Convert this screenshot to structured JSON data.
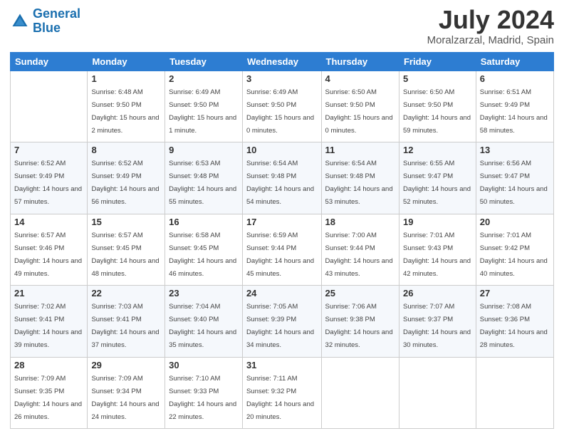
{
  "logo": {
    "line1": "General",
    "line2": "Blue"
  },
  "title": "July 2024",
  "location": "Moralzarzal, Madrid, Spain",
  "weekdays": [
    "Sunday",
    "Monday",
    "Tuesday",
    "Wednesday",
    "Thursday",
    "Friday",
    "Saturday"
  ],
  "weeks": [
    [
      {
        "date": "",
        "sunrise": "",
        "sunset": "",
        "daylight": ""
      },
      {
        "date": "1",
        "sunrise": "Sunrise: 6:48 AM",
        "sunset": "Sunset: 9:50 PM",
        "daylight": "Daylight: 15 hours and 2 minutes."
      },
      {
        "date": "2",
        "sunrise": "Sunrise: 6:49 AM",
        "sunset": "Sunset: 9:50 PM",
        "daylight": "Daylight: 15 hours and 1 minute."
      },
      {
        "date": "3",
        "sunrise": "Sunrise: 6:49 AM",
        "sunset": "Sunset: 9:50 PM",
        "daylight": "Daylight: 15 hours and 0 minutes."
      },
      {
        "date": "4",
        "sunrise": "Sunrise: 6:50 AM",
        "sunset": "Sunset: 9:50 PM",
        "daylight": "Daylight: 15 hours and 0 minutes."
      },
      {
        "date": "5",
        "sunrise": "Sunrise: 6:50 AM",
        "sunset": "Sunset: 9:50 PM",
        "daylight": "Daylight: 14 hours and 59 minutes."
      },
      {
        "date": "6",
        "sunrise": "Sunrise: 6:51 AM",
        "sunset": "Sunset: 9:49 PM",
        "daylight": "Daylight: 14 hours and 58 minutes."
      }
    ],
    [
      {
        "date": "7",
        "sunrise": "Sunrise: 6:52 AM",
        "sunset": "Sunset: 9:49 PM",
        "daylight": "Daylight: 14 hours and 57 minutes."
      },
      {
        "date": "8",
        "sunrise": "Sunrise: 6:52 AM",
        "sunset": "Sunset: 9:49 PM",
        "daylight": "Daylight: 14 hours and 56 minutes."
      },
      {
        "date": "9",
        "sunrise": "Sunrise: 6:53 AM",
        "sunset": "Sunset: 9:48 PM",
        "daylight": "Daylight: 14 hours and 55 minutes."
      },
      {
        "date": "10",
        "sunrise": "Sunrise: 6:54 AM",
        "sunset": "Sunset: 9:48 PM",
        "daylight": "Daylight: 14 hours and 54 minutes."
      },
      {
        "date": "11",
        "sunrise": "Sunrise: 6:54 AM",
        "sunset": "Sunset: 9:48 PM",
        "daylight": "Daylight: 14 hours and 53 minutes."
      },
      {
        "date": "12",
        "sunrise": "Sunrise: 6:55 AM",
        "sunset": "Sunset: 9:47 PM",
        "daylight": "Daylight: 14 hours and 52 minutes."
      },
      {
        "date": "13",
        "sunrise": "Sunrise: 6:56 AM",
        "sunset": "Sunset: 9:47 PM",
        "daylight": "Daylight: 14 hours and 50 minutes."
      }
    ],
    [
      {
        "date": "14",
        "sunrise": "Sunrise: 6:57 AM",
        "sunset": "Sunset: 9:46 PM",
        "daylight": "Daylight: 14 hours and 49 minutes."
      },
      {
        "date": "15",
        "sunrise": "Sunrise: 6:57 AM",
        "sunset": "Sunset: 9:45 PM",
        "daylight": "Daylight: 14 hours and 48 minutes."
      },
      {
        "date": "16",
        "sunrise": "Sunrise: 6:58 AM",
        "sunset": "Sunset: 9:45 PM",
        "daylight": "Daylight: 14 hours and 46 minutes."
      },
      {
        "date": "17",
        "sunrise": "Sunrise: 6:59 AM",
        "sunset": "Sunset: 9:44 PM",
        "daylight": "Daylight: 14 hours and 45 minutes."
      },
      {
        "date": "18",
        "sunrise": "Sunrise: 7:00 AM",
        "sunset": "Sunset: 9:44 PM",
        "daylight": "Daylight: 14 hours and 43 minutes."
      },
      {
        "date": "19",
        "sunrise": "Sunrise: 7:01 AM",
        "sunset": "Sunset: 9:43 PM",
        "daylight": "Daylight: 14 hours and 42 minutes."
      },
      {
        "date": "20",
        "sunrise": "Sunrise: 7:01 AM",
        "sunset": "Sunset: 9:42 PM",
        "daylight": "Daylight: 14 hours and 40 minutes."
      }
    ],
    [
      {
        "date": "21",
        "sunrise": "Sunrise: 7:02 AM",
        "sunset": "Sunset: 9:41 PM",
        "daylight": "Daylight: 14 hours and 39 minutes."
      },
      {
        "date": "22",
        "sunrise": "Sunrise: 7:03 AM",
        "sunset": "Sunset: 9:41 PM",
        "daylight": "Daylight: 14 hours and 37 minutes."
      },
      {
        "date": "23",
        "sunrise": "Sunrise: 7:04 AM",
        "sunset": "Sunset: 9:40 PM",
        "daylight": "Daylight: 14 hours and 35 minutes."
      },
      {
        "date": "24",
        "sunrise": "Sunrise: 7:05 AM",
        "sunset": "Sunset: 9:39 PM",
        "daylight": "Daylight: 14 hours and 34 minutes."
      },
      {
        "date": "25",
        "sunrise": "Sunrise: 7:06 AM",
        "sunset": "Sunset: 9:38 PM",
        "daylight": "Daylight: 14 hours and 32 minutes."
      },
      {
        "date": "26",
        "sunrise": "Sunrise: 7:07 AM",
        "sunset": "Sunset: 9:37 PM",
        "daylight": "Daylight: 14 hours and 30 minutes."
      },
      {
        "date": "27",
        "sunrise": "Sunrise: 7:08 AM",
        "sunset": "Sunset: 9:36 PM",
        "daylight": "Daylight: 14 hours and 28 minutes."
      }
    ],
    [
      {
        "date": "28",
        "sunrise": "Sunrise: 7:09 AM",
        "sunset": "Sunset: 9:35 PM",
        "daylight": "Daylight: 14 hours and 26 minutes."
      },
      {
        "date": "29",
        "sunrise": "Sunrise: 7:09 AM",
        "sunset": "Sunset: 9:34 PM",
        "daylight": "Daylight: 14 hours and 24 minutes."
      },
      {
        "date": "30",
        "sunrise": "Sunrise: 7:10 AM",
        "sunset": "Sunset: 9:33 PM",
        "daylight": "Daylight: 14 hours and 22 minutes."
      },
      {
        "date": "31",
        "sunrise": "Sunrise: 7:11 AM",
        "sunset": "Sunset: 9:32 PM",
        "daylight": "Daylight: 14 hours and 20 minutes."
      },
      {
        "date": "",
        "sunrise": "",
        "sunset": "",
        "daylight": ""
      },
      {
        "date": "",
        "sunrise": "",
        "sunset": "",
        "daylight": ""
      },
      {
        "date": "",
        "sunrise": "",
        "sunset": "",
        "daylight": ""
      }
    ]
  ]
}
